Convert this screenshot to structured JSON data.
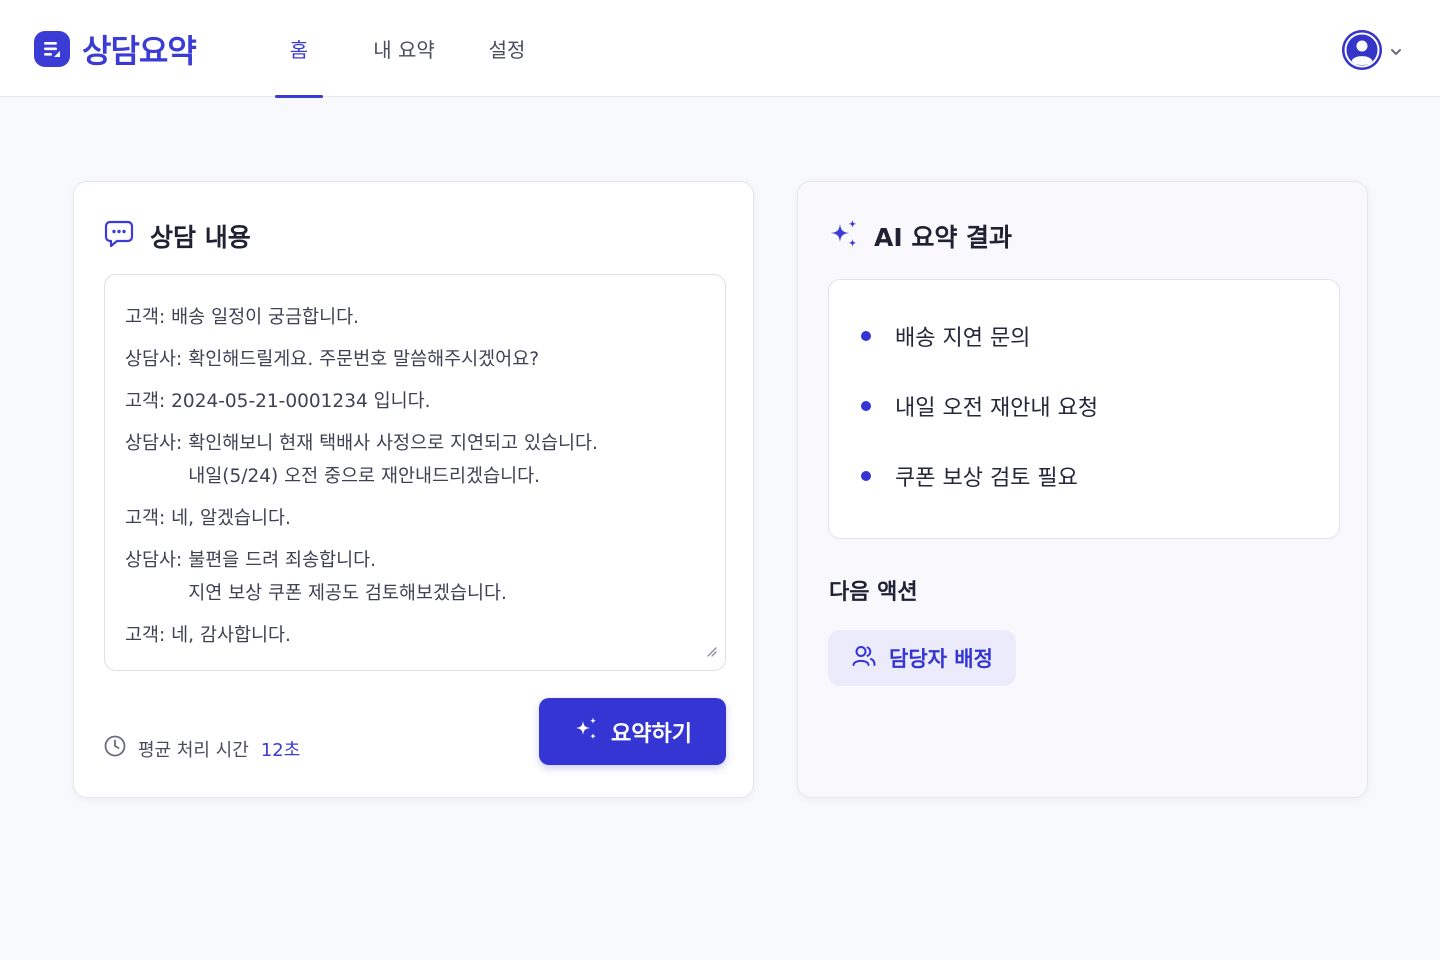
{
  "app": {
    "name": "상담요약"
  },
  "nav": {
    "tabs": [
      {
        "label": "홈",
        "active": true
      },
      {
        "label": "내 요약",
        "active": false
      },
      {
        "label": "설정",
        "active": false
      }
    ]
  },
  "colors": {
    "accent": "#3b3bd6",
    "background": "#f8f9fc"
  },
  "icons": {
    "logo": "document-lines-icon",
    "profile": "user-avatar-icon",
    "dropdown": "chevron-down-icon",
    "consult": "chat-bubble-icon",
    "ai": "sparkles-icon",
    "clock": "clock-icon",
    "assign": "users-icon",
    "resize": "resize-handle-icon"
  },
  "consult": {
    "title": "상담 내용",
    "messages": [
      {
        "speaker": "고객: ",
        "lines": [
          "배송 일정이 궁금합니다."
        ]
      },
      {
        "speaker": "상담사: ",
        "lines": [
          "확인해드릴게요. 주문번호 말씀해주시겠어요?"
        ]
      },
      {
        "speaker": "고객: ",
        "lines": [
          "2024-05-21-0001234 입니다."
        ]
      },
      {
        "speaker": "상담사: ",
        "lines": [
          "확인해보니 현재 택배사 사정으로 지연되고 있습니다.",
          "내일(5/24) 오전 중으로 재안내드리겠습니다."
        ]
      },
      {
        "speaker": "고객: ",
        "lines": [
          "네, 알겠습니다."
        ]
      },
      {
        "speaker": "상담사: ",
        "lines": [
          "불편을 드려 죄송합니다.",
          "지연 보상 쿠폰 제공도 검토해보겠습니다."
        ]
      },
      {
        "speaker": "고객: ",
        "lines": [
          "네, 감사합니다."
        ]
      }
    ],
    "avg_label": "평균 처리 시간",
    "avg_value": "12초",
    "summarize_button": "요약하기"
  },
  "summary": {
    "title": "AI 요약 결과",
    "items": [
      "배송 지연 문의",
      "내일 오전 재안내 요청",
      "쿠폰 보상 검토 필요"
    ],
    "next_actions_title": "다음 액션",
    "assign_button": "담당자 배정"
  }
}
